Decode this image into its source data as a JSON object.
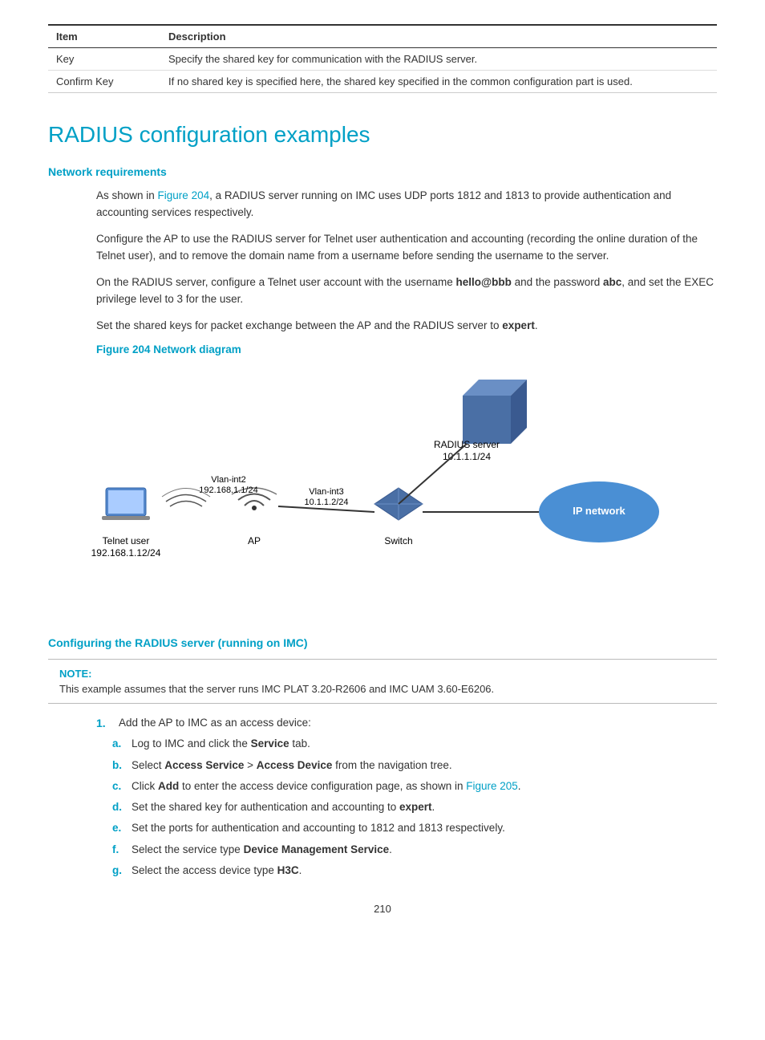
{
  "table": {
    "headers": [
      "Item",
      "Description"
    ],
    "rows": [
      {
        "item": "Key",
        "description": "Specify the shared key for communication with the RADIUS server."
      },
      {
        "item": "Confirm Key",
        "description": "If no shared key is specified here, the shared key specified in the common configuration part is used."
      }
    ]
  },
  "section": {
    "title": "RADIUS configuration examples",
    "network_requirements": {
      "heading": "Network requirements",
      "paragraphs": [
        "As shown in Figure 204, a RADIUS server running on IMC uses UDP ports 1812 and 1813 to provide authentication and accounting services respectively.",
        "Configure the AP to use the RADIUS server for Telnet user authentication and accounting (recording the online duration of the Telnet user), and to remove the domain name from a username before sending the username to the server.",
        "On the RADIUS server, configure a Telnet user account with the username hello@bbb and the password abc, and set the EXEC privilege level to 3 for the user.",
        "Set the shared keys for packet exchange between the AP and the RADIUS server to expert."
      ],
      "figure_label": "Figure 204 Network diagram",
      "diagram": {
        "radius_server_label": "RADIUS server",
        "radius_server_ip": "10.1.1.1/24",
        "vlan_int2_label": "Vlan-int2",
        "vlan_int2_ip": "192.168.1.1/24",
        "vlan_int3_label": "Vlan-int3",
        "vlan_int3_ip": "10.1.1.2/24",
        "telnet_user_label": "Telnet user",
        "telnet_user_ip": "192.168.1.12/24",
        "ap_label": "AP",
        "switch_label": "Switch",
        "ip_network_label": "IP network"
      }
    },
    "configuring": {
      "heading": "Configuring the RADIUS server (running on IMC)",
      "note_label": "NOTE:",
      "note_text": "This example assumes that the server runs IMC PLAT 3.20-R2606 and IMC UAM 3.60-E6206.",
      "step1_text": "Add the AP to IMC as an access device:",
      "substeps": [
        {
          "letter": "a.",
          "text": "Log to IMC and click the ",
          "bold": "Service",
          "rest": " tab."
        },
        {
          "letter": "b.",
          "text": "Select ",
          "bold": "Access Service",
          "mid": " > ",
          "bold2": "Access Device",
          "rest": " from the navigation tree."
        },
        {
          "letter": "c.",
          "text": "Click ",
          "bold": "Add",
          "rest": " to enter the access device configuration page, as shown in Figure 205."
        },
        {
          "letter": "d.",
          "text": "Set the shared key for authentication and accounting to ",
          "bold": "expert",
          "rest": "."
        },
        {
          "letter": "e.",
          "text": "Set the ports for authentication and accounting to 1812 and 1813 respectively."
        },
        {
          "letter": "f.",
          "text": "Select the service type ",
          "bold": "Device Management Service",
          "rest": "."
        },
        {
          "letter": "g.",
          "text": "Select the access device type ",
          "bold": "H3C",
          "rest": "."
        }
      ]
    }
  },
  "page_number": "210"
}
